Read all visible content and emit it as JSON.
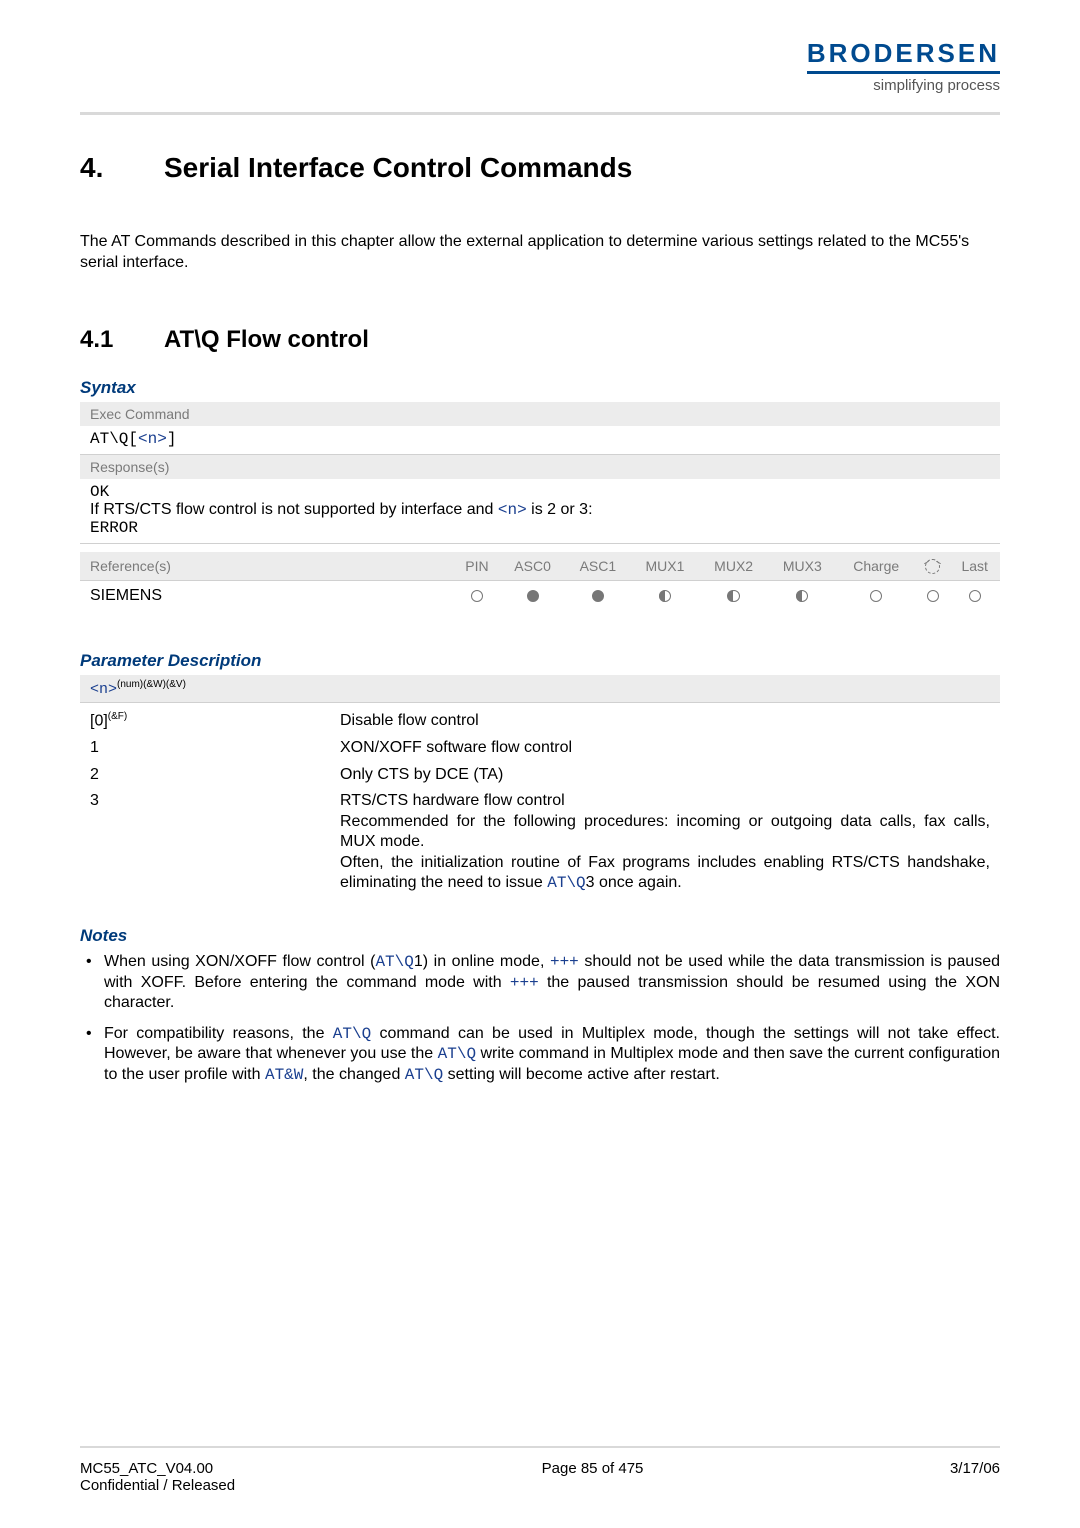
{
  "brand": {
    "name": "BRODERSEN",
    "tagline": "simplifying process"
  },
  "chapter": {
    "number": "4.",
    "title": "Serial Interface Control Commands"
  },
  "intro": "The AT Commands described in this chapter allow the external application to determine various settings related to the MC55's serial interface.",
  "section": {
    "number": "4.1",
    "title": "AT\\Q   Flow control"
  },
  "syntax": {
    "heading": "Syntax",
    "exec_label": "Exec Command",
    "exec_cmd_prefix": "AT\\Q[",
    "exec_cmd_param": "<n>",
    "exec_cmd_suffix": "]",
    "response_label": "Response(s)",
    "response_line1": "OK",
    "response_line2_pre": "If RTS/CTS flow control is not supported by interface and ",
    "response_line2_param": "<n>",
    "response_line2_post": " is 2 or 3:",
    "response_line3": "ERROR"
  },
  "reference": {
    "label": "Reference(s)",
    "vendor": "SIEMENS",
    "cols": [
      "PIN",
      "ASC0",
      "ASC1",
      "MUX1",
      "MUX2",
      "MUX3",
      "Charge",
      "",
      "Last"
    ],
    "vals": [
      "empty",
      "full",
      "full",
      "half",
      "half",
      "half",
      "empty",
      "empty",
      "empty"
    ]
  },
  "params": {
    "heading": "Parameter Description",
    "header_param": "<n>",
    "header_sup": "(num)(&W)(&V)",
    "rows": [
      {
        "val": "[0]",
        "val_sup": "(&F)",
        "desc": "Disable flow control"
      },
      {
        "val": "1",
        "val_sup": "",
        "desc": "XON/XOFF software flow control"
      },
      {
        "val": "2",
        "val_sup": "",
        "desc": "Only CTS by DCE (TA)"
      }
    ],
    "row3": {
      "val": "3",
      "desc_line1": "RTS/CTS hardware flow control",
      "desc_line2": "Recommended for the following procedures: incoming or outgoing data calls, fax calls, MUX mode.",
      "desc_line3_pre": "Often, the initialization routine of Fax programs includes enabling RTS/CTS handshake, eliminating the need to issue ",
      "desc_line3_cmd": "AT\\Q",
      "desc_line3_post": "3 once again."
    }
  },
  "notes": {
    "heading": "Notes",
    "n1_a": "When using XON/XOFF flow control (",
    "n1_cmd1": "AT\\Q",
    "n1_b": "1) in online mode, ",
    "n1_cmd2": "+++",
    "n1_c": " should not be used while the data transmission is paused with XOFF. Before entering the command mode with ",
    "n1_cmd3": "+++",
    "n1_d": " the paused transmission should be resumed using the XON character.",
    "n2_a": "For compatibility reasons, the ",
    "n2_cmd1": "AT\\Q",
    "n2_b": " command can be used in Multiplex mode, though the settings will not take effect. However, be aware that whenever you use the ",
    "n2_cmd2": "AT\\Q",
    "n2_c": " write command in Multiplex mode and then save the current configuration to the user profile with ",
    "n2_cmd3": "AT&W",
    "n2_d": ", the changed ",
    "n2_cmd4": "AT\\Q",
    "n2_e": " setting will become active after restart."
  },
  "footer": {
    "doc": "MC55_ATC_V04.00",
    "conf": "Confidential / Released",
    "page": "Page 85 of 475",
    "date": "3/17/06"
  }
}
